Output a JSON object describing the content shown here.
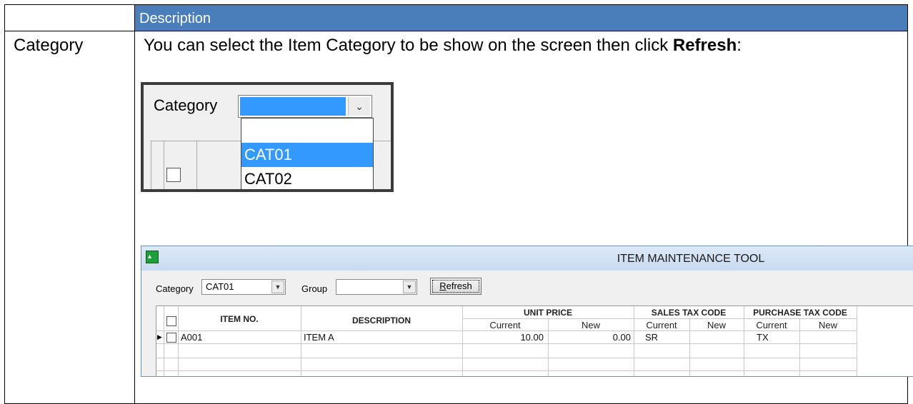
{
  "doc": {
    "header_col1": "",
    "header_col2": "Description",
    "field_name": "Category",
    "description_lead": "You can select the Item Category to be show on the screen then click ",
    "description_bold": "Refresh",
    "description_tail": ":"
  },
  "dropdown_shot": {
    "label": "Category",
    "arrow_glyph": "⌄",
    "options": [
      "",
      "CAT01",
      "CAT02"
    ],
    "highlighted": "CAT01"
  },
  "window": {
    "title": "ITEM MAINTENANCE TOOL",
    "category_label": "Category",
    "category_value": "CAT01",
    "group_label": "Group",
    "group_value": "",
    "refresh_label_first": "R",
    "refresh_label_rest": "efresh",
    "grid": {
      "headers": {
        "item_no": "ITEM NO.",
        "description": "DESCRIPTION",
        "unit_price": "UNIT PRICE",
        "sales_tax_code": "SALES TAX CODE",
        "purchase_tax_code": "PURCHASE TAX CODE",
        "current": "Current",
        "new": "New"
      },
      "rows": [
        {
          "item_no": "A001",
          "description": "ITEM A",
          "unit_price_current": "10.00",
          "unit_price_new": "0.00",
          "sales_tax_current": "SR",
          "sales_tax_new": "",
          "purchase_tax_current": "TX",
          "purchase_tax_new": ""
        }
      ]
    }
  }
}
